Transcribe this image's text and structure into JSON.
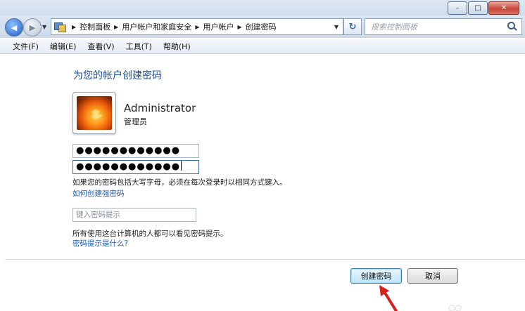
{
  "window": {
    "caption_minimize": "–",
    "caption_maximize": "□",
    "caption_close": "✕"
  },
  "nav": {
    "back_icon": "◀",
    "forward_icon": "▶",
    "refresh_icon": "↻",
    "breadcrumbs": [
      "控制面板",
      "用户帐户和家庭安全",
      "用户帐户",
      "创建密码"
    ],
    "search_placeholder": "搜索控制面板"
  },
  "menu": [
    "文件(F)",
    "编辑(E)",
    "查看(V)",
    "工具(T)",
    "帮助(H)"
  ],
  "main": {
    "title": "为您的帐户创建密码",
    "user": {
      "name": "Administrator",
      "role": "管理员"
    },
    "password_value": "●●●●●●●●●●●●",
    "confirm_value": "●●●●●●●●●●●●",
    "case_note": "如果您的密码包括大写字母，必须在每次登录时以相同方式键入。",
    "strong_password_link": "如何创建强密码",
    "hint_placeholder": "键入密码提示",
    "hint_note": "所有使用这台计算机的人都可以看见密码提示。",
    "hint_link": "密码提示是什么?",
    "create_button": "创建密码",
    "cancel_button": "取消"
  },
  "colors": {
    "title_blue": "#1d4f9c",
    "link_blue": "#1c58b8",
    "annotation_red": "#d6201a"
  }
}
